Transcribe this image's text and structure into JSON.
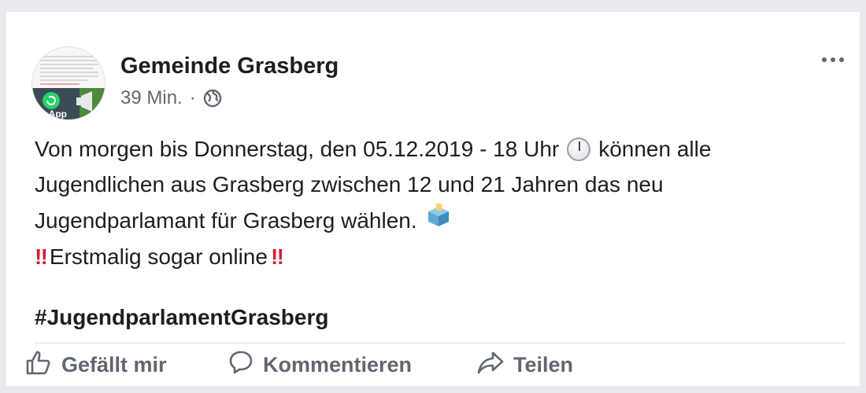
{
  "post": {
    "author": "Gemeinde Grasberg",
    "time": "39 Min.",
    "separator": "·",
    "avatar_text": "sApp",
    "body": {
      "line1_a": "Von morgen bis Donnerstag, den 05.12.2019 - 18 Uhr",
      "line1_b": "können alle",
      "line2": "Jugendlichen aus Grasberg zwischen 12 und 21 Jahren das neu",
      "line3": "Jugendparlamant für Grasberg wählen.",
      "line4_marks": "‼",
      "line4_text": "Erstmalig sogar online",
      "hashtag": "#JugendparlamentGrasberg"
    }
  },
  "actions": {
    "like": "Gefällt mir",
    "comment": "Kommentieren",
    "share": "Teilen"
  },
  "icons": {
    "privacy": "globe-icon",
    "more": "more-options-icon",
    "clock": "clock-icon",
    "ballot": "ballot-box-icon",
    "like": "thumbs-up-icon",
    "comment": "comment-icon",
    "share": "share-icon"
  },
  "colors": {
    "name": "#1c1e21",
    "secondary": "#606770",
    "whatsapp_green": "#25d366",
    "warning_red": "#d3212f"
  }
}
